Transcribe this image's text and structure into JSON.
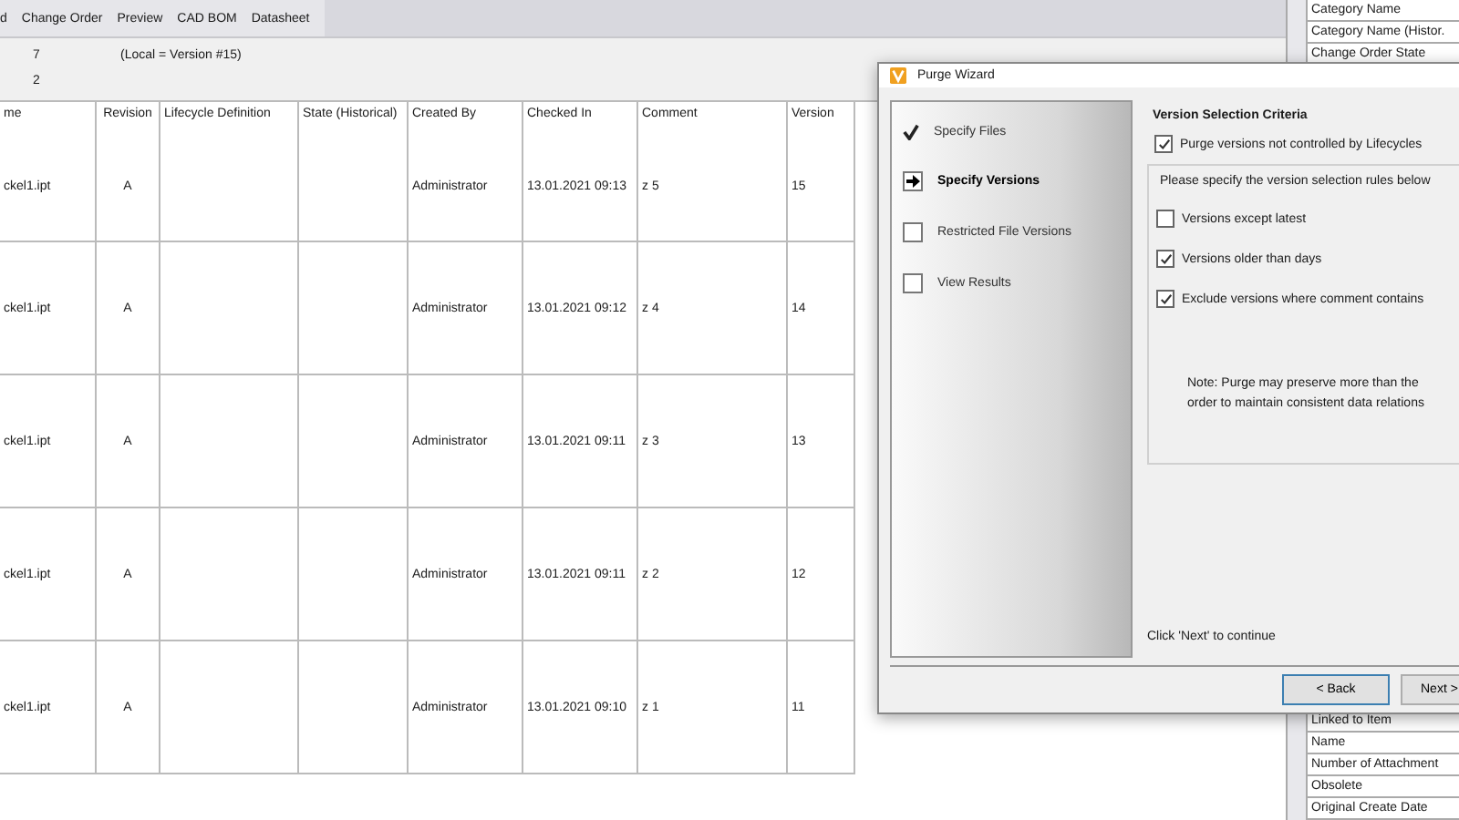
{
  "tabs": [
    {
      "label": "d"
    },
    {
      "label": "Change Order"
    },
    {
      "label": "Preview"
    },
    {
      "label": "CAD BOM"
    },
    {
      "label": "Datasheet"
    }
  ],
  "info": {
    "row_1_value": "7",
    "row_1_note": "(Local = Version #15)",
    "row_2_value": "2"
  },
  "table": {
    "columns": [
      "me",
      "Revision",
      "Lifecycle Definition",
      "State (Historical)",
      "Created By",
      "Checked In",
      "Comment",
      "Version"
    ],
    "rows": [
      [
        "ckel1.ipt",
        "A",
        "",
        "",
        "Administrator",
        "13.01.2021 09:13",
        "z 5",
        "15"
      ],
      [
        "ckel1.ipt",
        "A",
        "",
        "",
        "Administrator",
        "13.01.2021 09:12",
        "z 4",
        "14"
      ],
      [
        "ckel1.ipt",
        "A",
        "",
        "",
        "Administrator",
        "13.01.2021 09:11",
        "z 3",
        "13"
      ],
      [
        "ckel1.ipt",
        "A",
        "",
        "",
        "Administrator",
        "13.01.2021 09:11",
        "z 2",
        "12"
      ],
      [
        "ckel1.ipt",
        "A",
        "",
        "",
        "Administrator",
        "13.01.2021 09:10",
        "z 1",
        "11"
      ]
    ]
  },
  "properties_top": [
    "Category Name",
    "Category Name (Histor.",
    "Change Order State"
  ],
  "properties_bottom": [
    "Linked to Item",
    "Name",
    "Number of Attachment",
    "Obsolete",
    "Original Create Date"
  ],
  "dialog": {
    "title": "Purge Wizard",
    "steps": [
      {
        "label": "Specify Files",
        "kind": "done",
        "selected": false
      },
      {
        "label": "Specify Versions",
        "kind": "current",
        "selected": true
      },
      {
        "label": "Restricted File Versions",
        "kind": "pending",
        "selected": false
      },
      {
        "label": "View Results",
        "kind": "pending",
        "selected": false
      }
    ],
    "heading": "Version Selection Criteria",
    "main_option": {
      "label": "Purge versions not controlled by Lifecycles",
      "checked": true
    },
    "group_caption": "Please specify the version selection rules below",
    "options": [
      {
        "label": "Versions except latest",
        "checked": false
      },
      {
        "label": "Versions older than days",
        "checked": true
      },
      {
        "label": "Exclude versions where comment contains",
        "checked": true
      }
    ],
    "note_lines": [
      "Note: Purge may preserve more than the",
      "order to maintain consistent data relations"
    ],
    "footer_hint": "Click 'Next' to continue",
    "buttons": [
      "< Back",
      "Next >"
    ]
  }
}
